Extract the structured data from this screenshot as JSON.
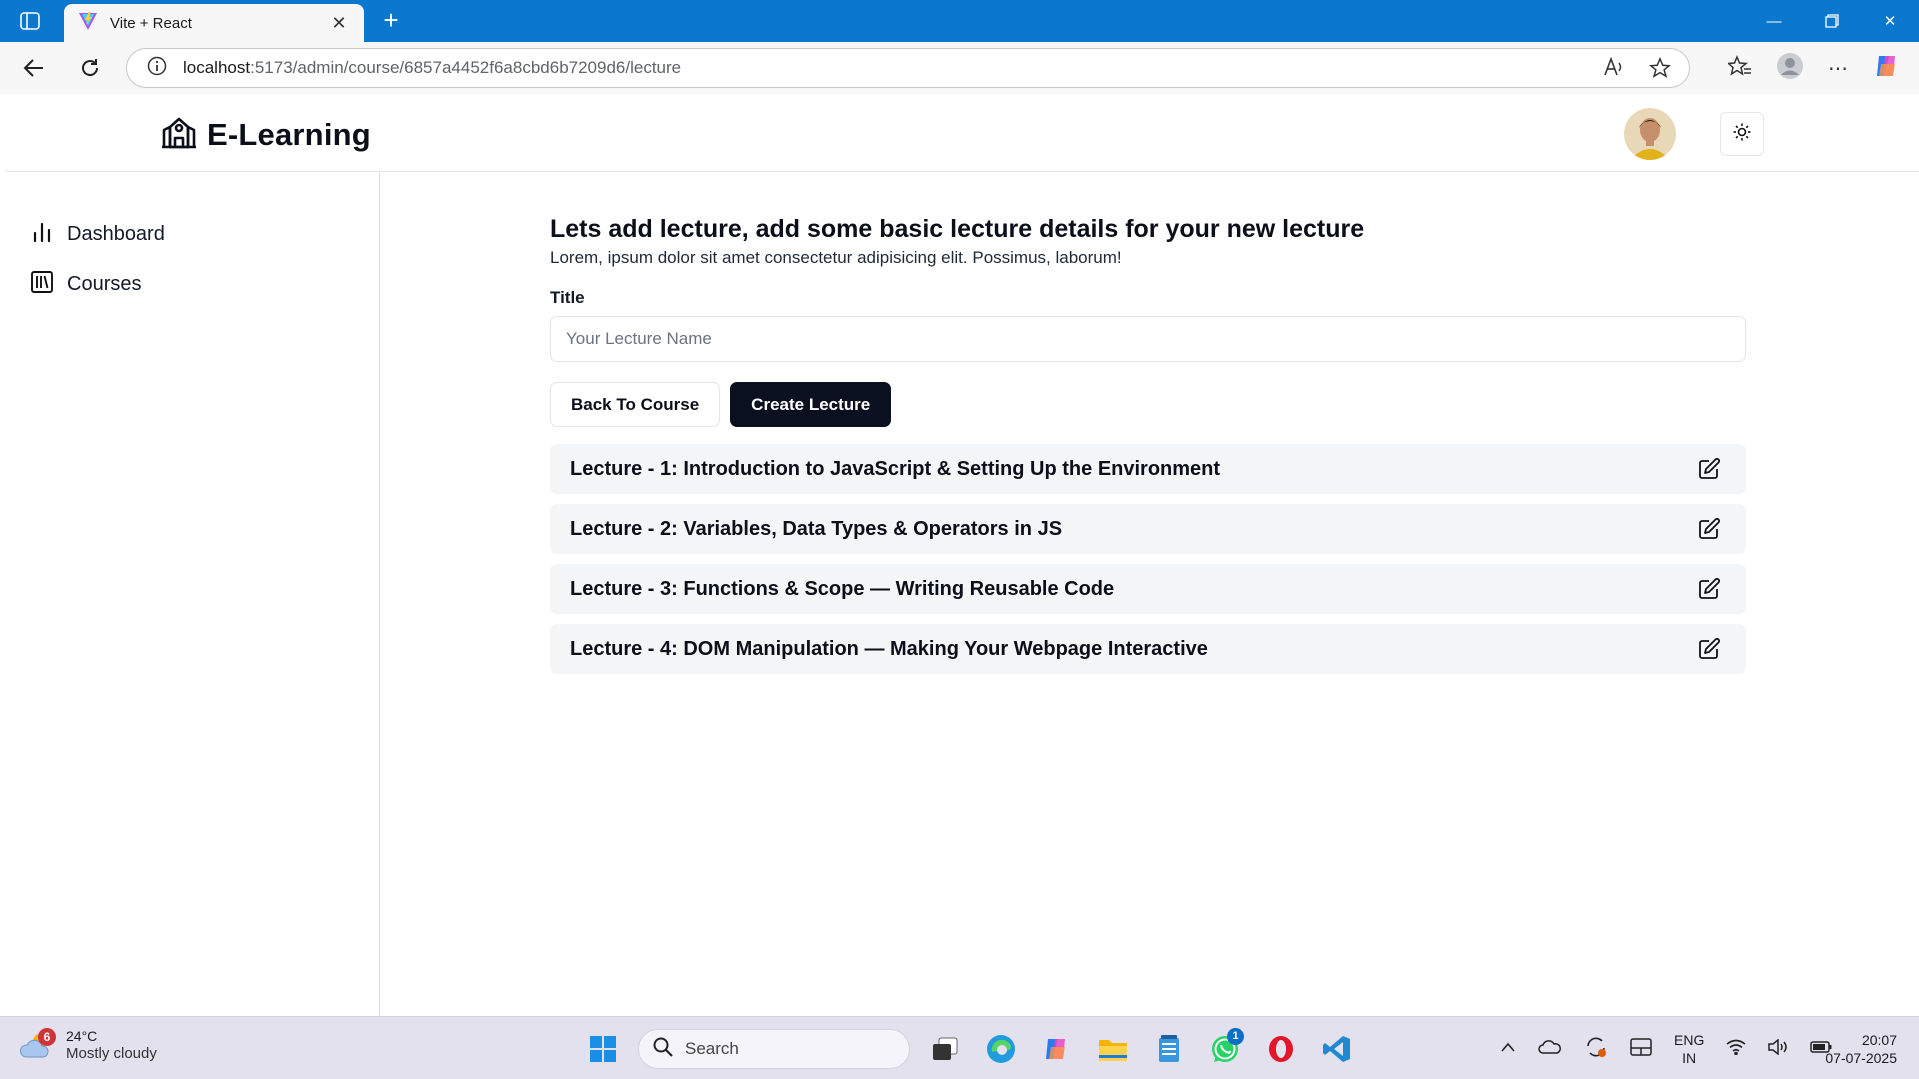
{
  "browser": {
    "tab_title": "Vite + React",
    "url_host": "localhost",
    "url_path": ":5173/admin/course/6857a4452f6a8cbd6b7209d6/lecture"
  },
  "app": {
    "brand": "E-Learning",
    "sidebar": {
      "items": [
        {
          "label": "Dashboard",
          "icon": "bar-chart-icon"
        },
        {
          "label": "Courses",
          "icon": "library-icon"
        }
      ]
    },
    "main": {
      "heading": "Lets add lecture, add some basic lecture details for your new lecture",
      "subtext": "Lorem, ipsum dolor sit amet consectetur adipisicing elit. Possimus, laborum!",
      "title_label": "Title",
      "title_value": "",
      "title_placeholder": "Your Lecture Name",
      "back_button": "Back To Course",
      "create_button": "Create Lecture",
      "lectures": [
        {
          "title": "Lecture - 1: Introduction to JavaScript & Setting Up the Environment"
        },
        {
          "title": "Lecture - 2: Variables, Data Types & Operators in JS"
        },
        {
          "title": "Lecture - 3: Functions & Scope — Writing Reusable Code"
        },
        {
          "title": "Lecture - 4: DOM Manipulation — Making Your Webpage Interactive"
        }
      ]
    }
  },
  "taskbar": {
    "weather_badge": "6",
    "weather_temp": "24°C",
    "weather_desc": "Mostly cloudy",
    "search_label": "Search",
    "whatsapp_badge": "1",
    "lang_line1": "ENG",
    "lang_line2": "IN",
    "time": "20:07",
    "date": "07-07-2025"
  },
  "colors": {
    "titlebar": "#0b78d0",
    "primary_button": "#0b1020",
    "lecture_row_bg": "#f4f5f7",
    "taskbar_bg": "#e4e1ef"
  }
}
